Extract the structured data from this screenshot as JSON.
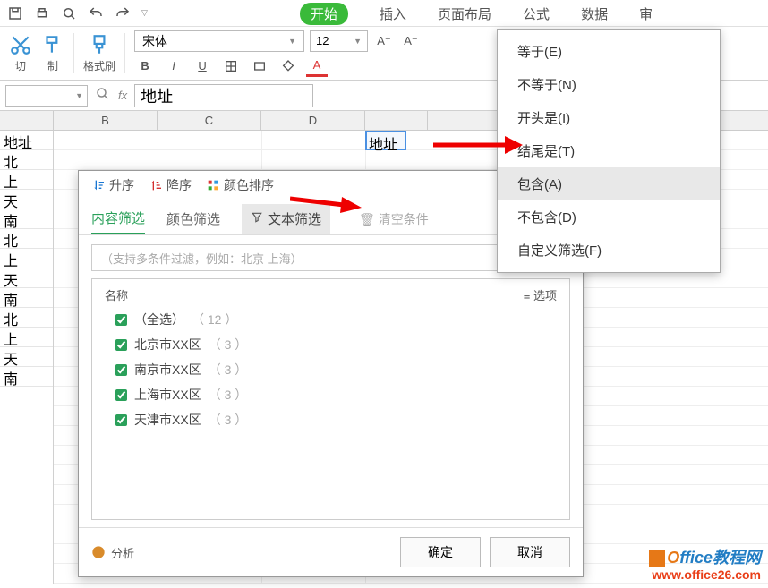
{
  "tabs": {
    "start": "开始",
    "insert": "插入",
    "layout": "页面布局",
    "formula": "公式",
    "data": "数据",
    "review": "审"
  },
  "ribbon": {
    "cut": "切",
    "copy": "制",
    "brush": "格式刷",
    "font_name": "宋体",
    "font_size": "12"
  },
  "formula_bar": {
    "fx": "fx",
    "value": "地址"
  },
  "cols": {
    "B": "B",
    "C": "C",
    "D": "D"
  },
  "colA": [
    "地址",
    "北",
    "上",
    "天",
    "南",
    "北",
    "上",
    "天",
    "南",
    "北",
    "上",
    "天",
    "南"
  ],
  "active_cell": "地址",
  "ctx": {
    "eq": "等于(E)",
    "neq": "不等于(N)",
    "begins": "开头是(I)",
    "ends": "结尾是(T)",
    "contains": "包含(A)",
    "ncontains": "不包含(D)",
    "custom": "自定义筛选(F)"
  },
  "filter": {
    "asc": "升序",
    "desc": "降序",
    "color_sort": "颜色排序",
    "tab_content": "内容筛选",
    "tab_color": "颜色筛选",
    "tab_text": "文本筛选",
    "clear": "清空条件",
    "search_ph": "（支持多条件过滤，例如：北京  上海）",
    "hdr_name": "名称",
    "hdr_opt": "选项",
    "items": [
      {
        "label": "（全选）",
        "count": "（ 12 ）"
      },
      {
        "label": "北京市XX区",
        "count": "（ 3 ）"
      },
      {
        "label": "南京市XX区",
        "count": "（ 3 ）"
      },
      {
        "label": "上海市XX区",
        "count": "（ 3 ）"
      },
      {
        "label": "天津市XX区",
        "count": "（ 3 ）"
      }
    ],
    "analyze": "分析",
    "ok": "确定",
    "cancel": "取消"
  },
  "watermark": {
    "l1a": "O",
    "l1b": "ffice教程网",
    "l2": "www.office26.com"
  }
}
